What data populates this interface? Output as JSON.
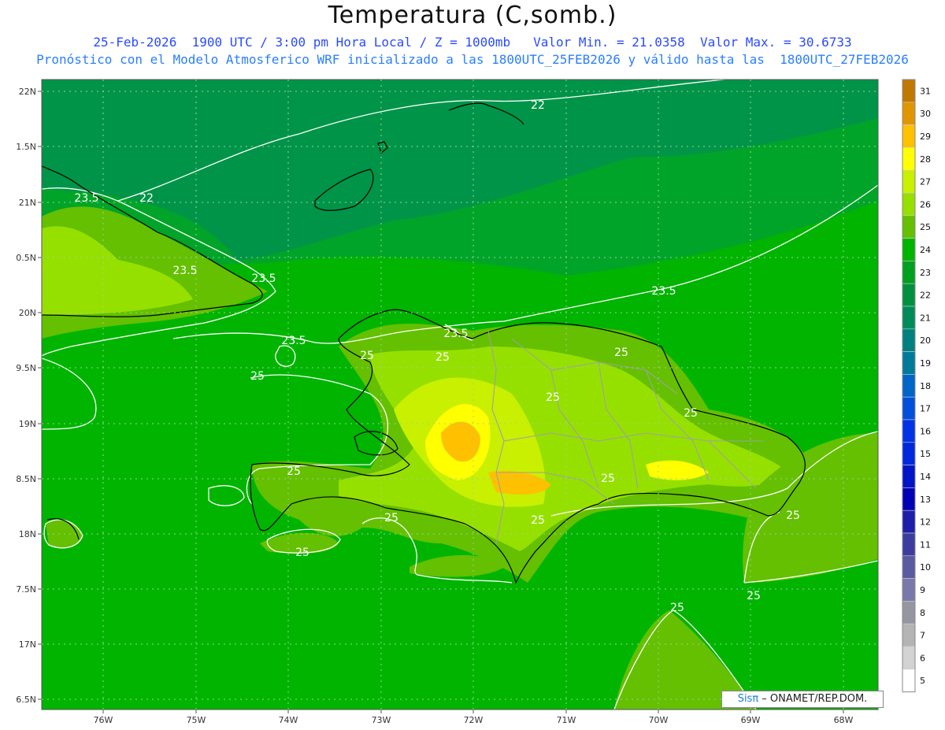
{
  "header": {
    "title": "Temperatura (C,somb.)",
    "line1": "25-Feb-2026  1900 UTC / 3:00 pm Hora Local / Z = 1000mb   Valor Min. = 21.0358  Valor Max. = 30.6733",
    "line2": "Pronóstico con el Modelo Atmosferico WRF inicializado a las 1800UTC_25FEB2026 y válido hasta las  1800UTC_27FEB2026"
  },
  "lat_labels": [
    "22N",
    "1.5N",
    "21N",
    "0.5N",
    "20N",
    "9.5N",
    "19N",
    "8.5N",
    "18N",
    "7.5N",
    "17N",
    "6.5N"
  ],
  "lon_labels": [
    "76W",
    "75W",
    "74W",
    "73W",
    "72W",
    "71W",
    "70W",
    "69W",
    "68W"
  ],
  "contour_labels": [
    "22",
    "22",
    "23.5",
    "23.5",
    "23.5",
    "23.5",
    "23.5",
    "23.5",
    "25",
    "25",
    "25",
    "25",
    "25",
    "25",
    "25",
    "25",
    "25",
    "25",
    "25",
    "25",
    "25",
    "25"
  ],
  "colorbar": {
    "values": [
      "31",
      "30",
      "29",
      "28",
      "27",
      "26",
      "25",
      "24",
      "23",
      "22",
      "21",
      "20",
      "19",
      "18",
      "17",
      "16",
      "15",
      "14",
      "13",
      "12",
      "11",
      "10",
      "9",
      "8",
      "7",
      "6",
      "5"
    ],
    "colors": [
      "#c07800",
      "#e09600",
      "#ffc000",
      "#ffff00",
      "#c8f000",
      "#96e000",
      "#64c000",
      "#00b400",
      "#00a020",
      "#009040",
      "#008c5a",
      "#008080",
      "#007a9a",
      "#0064c8",
      "#0050dc",
      "#0032e6",
      "#0028dc",
      "#0014c8",
      "#0000b4",
      "#1e1eaa",
      "#3c3ca0",
      "#5a5aa0",
      "#7878aa",
      "#9696a0",
      "#b4b4b4",
      "#d2d2d2",
      "#ffffff"
    ]
  },
  "credit": {
    "brand": "Sisπ",
    "text": " – ONAMET/REP.DOM."
  }
}
